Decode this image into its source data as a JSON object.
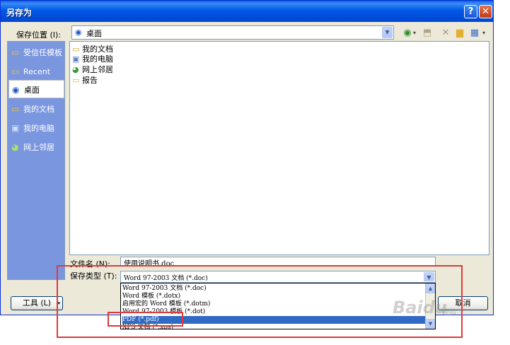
{
  "window": {
    "title": "另存为"
  },
  "toolbar": {
    "save_in_label": "保存位置 (I):",
    "location": "桌面",
    "icons": [
      "back-icon",
      "up-folder-icon",
      "delete-icon",
      "new-folder-icon",
      "views-icon"
    ]
  },
  "places": [
    {
      "label": "受信任模板",
      "icon": "folder-icon"
    },
    {
      "label": "Recent",
      "icon": "folder-icon"
    },
    {
      "label": "桌面",
      "icon": "desktop-icon",
      "selected": true
    },
    {
      "label": "我的文档",
      "icon": "documents-icon"
    },
    {
      "label": "我的电脑",
      "icon": "computer-icon"
    },
    {
      "label": "网上邻居",
      "icon": "network-icon"
    }
  ],
  "files": [
    {
      "name": "我的文档",
      "icon": "documents-icon"
    },
    {
      "name": "我的电脑",
      "icon": "computer-icon"
    },
    {
      "name": "网上邻居",
      "icon": "network-icon"
    },
    {
      "name": "报告",
      "icon": "folder-icon"
    }
  ],
  "filename": {
    "label": "文件名 (N):",
    "value": "使用说明书.doc"
  },
  "filetype": {
    "label": "保存类型 (T):",
    "value": "Word 97-2003 文档 (*.doc)",
    "options": [
      "Word 97-2003 文档 (*.doc)",
      "Word 模板 (*.dotx)",
      "启用宏的 Word 模板 (*.dotm)",
      "Word 97-2003 模板 (*.dot)",
      "PDF (*.pdf)",
      "XPS 文档 (*.xps)"
    ],
    "highlighted": "PDF (*.pdf)"
  },
  "buttons": {
    "tools": "工具 (L)",
    "cancel": "取消"
  },
  "watermark": {
    "text": "Baidu",
    "sub": "经验"
  },
  "colors": {
    "highlight": "#316ac5",
    "annotation_red": "#e03a3a",
    "titlebar": "#0058e6"
  }
}
